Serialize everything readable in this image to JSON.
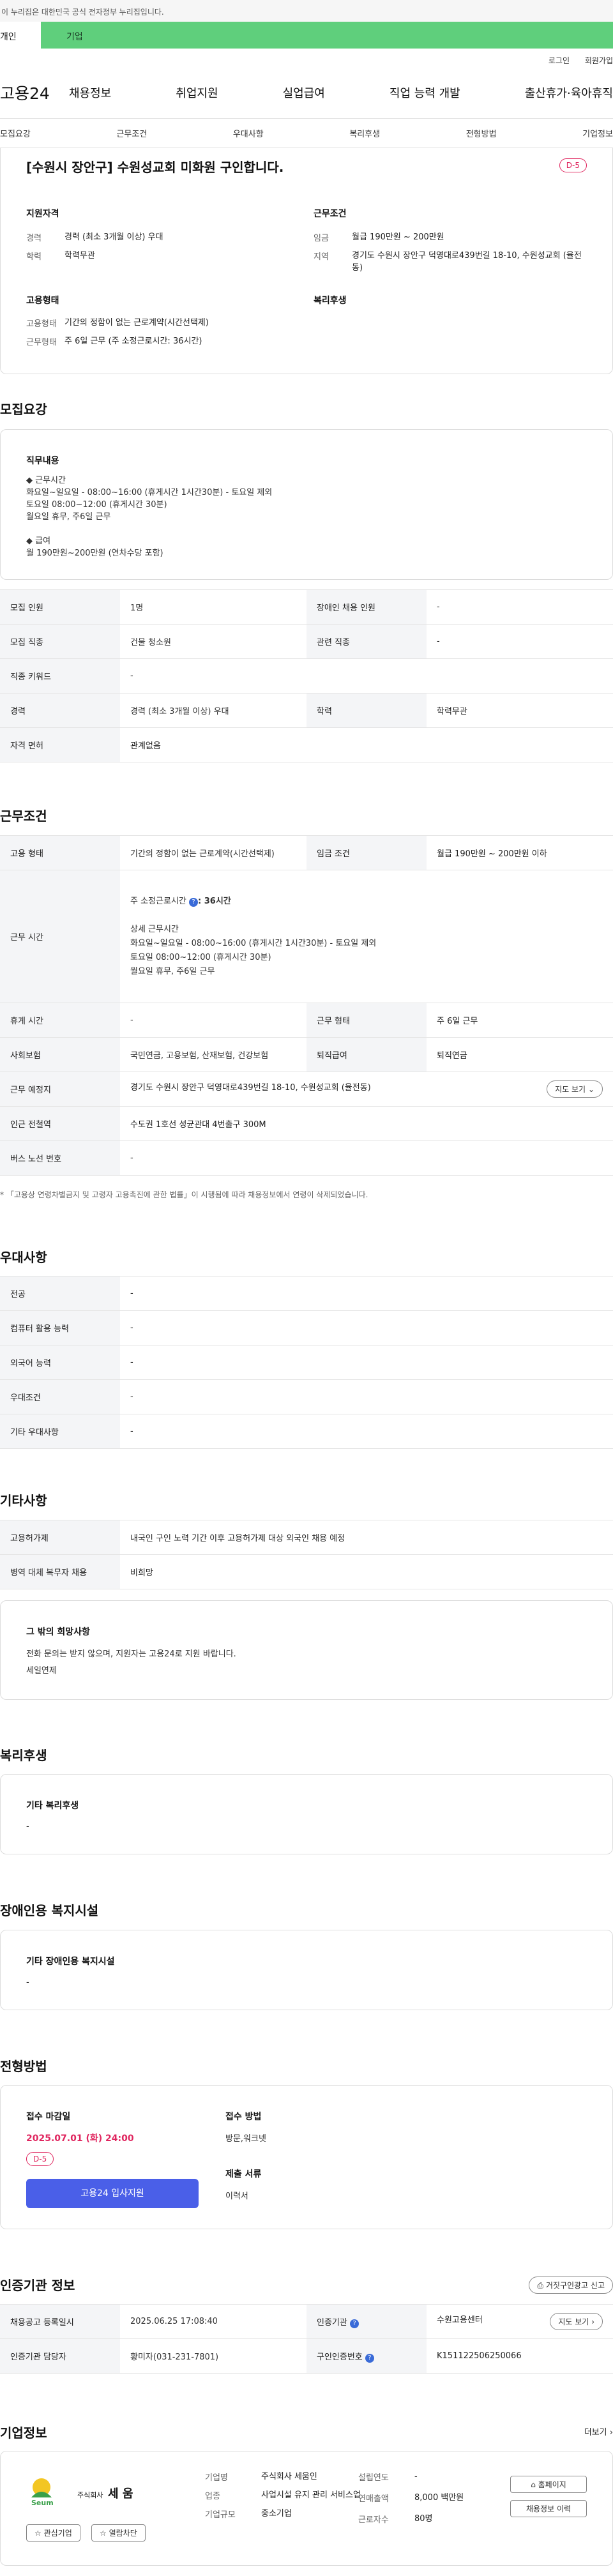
{
  "gov_banner": "이 누리집은 대한민국 공식 전자정부 누리집입니다.",
  "top_tabs": [
    "개인",
    "기업"
  ],
  "login_links": [
    "로그인",
    "회원가입"
  ],
  "logo": "고용24",
  "gnb": [
    "채용정보",
    "취업지원",
    "실업급여",
    "직업 능력 개발",
    "출산휴가·육아휴직"
  ],
  "snb": [
    "모집요강",
    "근무조건",
    "우대사항",
    "복리후생",
    "전형방법",
    "기업정보"
  ],
  "summary": {
    "title": "[수원시 장안구] 수원성교회 미화원 구인합니다.",
    "dday": "D-5",
    "left_heading": "지원자격",
    "left": [
      [
        "경력",
        "경력 (최소 3개월 이상) 우대"
      ],
      [
        "학력",
        "학력무관"
      ]
    ],
    "employment_heading": "고용형태",
    "employment": [
      [
        "고용형태",
        "기간의 정함이 없는 근로계약(시간선택제)"
      ],
      [
        "근무형태",
        "주 6일 근무 (주 소정근로시간: 36시간)"
      ]
    ],
    "right_heading": "근무조건",
    "right": [
      [
        "임금",
        "월급 190만원 ~ 200만원"
      ],
      [
        "지역",
        "경기도 수원시 장안구 덕영대로439번길 18-10, 수원성교회 (율전동)"
      ]
    ],
    "welfare_heading": "복리후생"
  },
  "recruit": {
    "heading": "모집요강",
    "duty_title": "직무내용",
    "duty_lines": [
      "◆ 근무시간",
      "화요일~일요일 - 08:00~16:00 (휴게시간 1시간30분) - 토요일 제외",
      "토요일 08:00~12:00 (휴게시간 30분)",
      "월요일 휴무, 주6일 근무",
      "",
      "◆ 급여",
      " 월 190만원~200만원 (연차수당 포함)"
    ],
    "rows": [
      [
        "모집 인원",
        "1명",
        "장애인 채용 인원",
        "-"
      ],
      [
        "모집 직종",
        "건물 청소원",
        "관련 직종",
        "-"
      ],
      [
        "직종 키워드",
        "-"
      ],
      [
        "경력",
        "경력 (최소 3개월 이상) 우대",
        "학력",
        "학력무관"
      ],
      [
        "자격 면허",
        "관계없음"
      ]
    ]
  },
  "conditions": {
    "heading": "근무조건",
    "emp_type": [
      "고용 형태",
      "기간의 정함이 없는 근로계약(시간선택제)",
      "임금 조건",
      "월급 190만원 ~ 200만원 이하"
    ],
    "work_time_label": "근무 시간",
    "weekly_hours": "주 소정근로시간",
    "weekly_hours_value": ": 36시간",
    "detail_label": "상세 근무시간",
    "detail_lines": [
      "화요일~일요일 - 08:00~16:00 (휴게시간 1시간30분) - 토요일 제외",
      "토요일 08:00~12:00 (휴게시간 30분)",
      "월요일 휴무, 주6일 근무"
    ],
    "rows": [
      [
        "휴게 시간",
        "-",
        "근무 형태",
        "주 6일 근무"
      ],
      [
        "사회보험",
        "국민연금, 고용보험, 산재보험, 건강보험",
        "퇴직급여",
        "퇴직연금"
      ]
    ],
    "place_label": "근무 예정지",
    "place_value": "경기도 수원시 장안구 덕영대로439번길 18-10, 수원성교회 (율전동)",
    "map_button": "지도 보기",
    "station_label": "인근 전철역",
    "station_value": "수도권 1호선 성균관대 4번출구 300M",
    "bus_label": "버스 노선 번호",
    "bus_value": "-",
    "footnote": "* 「고용상 연령차별금지 및 고령자 고용촉진에 관한 법률」이 시행됨에 따라 채용정보에서 연령이 삭제되었습니다."
  },
  "preference": {
    "heading": "우대사항",
    "rows": [
      [
        "전공",
        "-"
      ],
      [
        "컴퓨터 활용 능력",
        "-"
      ],
      [
        "외국어 능력",
        "-"
      ],
      [
        "우대조건",
        "-"
      ],
      [
        "기타 우대사항",
        "-"
      ]
    ]
  },
  "etc": {
    "heading": "기타사항",
    "rows": [
      [
        "고용허가제",
        "내국인 구인 노력 기간 이후 고용허가제 대상 외국인 채용 예정"
      ],
      [
        "병역 대체 복무자 채용",
        "비희망"
      ]
    ],
    "box_title": "그 밖의 희망사항",
    "box_lines": [
      "전화 문의는 받지 않으며, 지원자는 고용24로 지원 바랍니다.",
      "세일연제"
    ]
  },
  "welfare": {
    "heading": "복리후생",
    "box_title": "기타 복리후생",
    "box_value": "-"
  },
  "disabled": {
    "heading": "장애인용 복지시설",
    "box_title": "기타 장애인용 복지시설",
    "box_value": "-"
  },
  "selection": {
    "heading": "전형방법",
    "deadline_label": "접수 마감일",
    "deadline": "2025.07.01 (화) 24:00",
    "dday": "D-5",
    "apply_button": "고용24 입사지원",
    "method_label": "접수 방법",
    "method_value": "방문,워크넷",
    "docs_label": "제출 서류",
    "docs_value": "이력서"
  },
  "cert": {
    "heading": "인증기관 정보",
    "report_button": "거짓구인광고 신고",
    "rows": [
      [
        "채용공고 등록일시",
        "2025.06.25 17:08:40",
        "인증기관",
        "수원고용센터"
      ],
      [
        "인증기관 담당자",
        "황미자(031-231-7801)",
        "구인인증번호",
        "K151122506250066"
      ]
    ],
    "map_button": "지도 보기"
  },
  "company": {
    "heading": "기업정보",
    "more": "더보기",
    "logo_text": "Seum",
    "logo_sub": "주식회사",
    "logo_name": "세 움",
    "interest_button": "관심기업",
    "block_button": "열람차단",
    "fields_a": [
      [
        "기업명",
        "주식회사 세움인"
      ],
      [
        "업종",
        "사업시설 유지 관리 서비스업"
      ],
      [
        "기업규모",
        "중소기업"
      ]
    ],
    "fields_b": [
      [
        "설립연도",
        "-"
      ],
      [
        "연매출액",
        "8,000 백만원"
      ],
      [
        "근로자수",
        "80명"
      ]
    ],
    "homepage_button": "홈페이지",
    "jobs_button": "채용정보 이력"
  },
  "colors": {
    "brand_green": "#5fcf7c",
    "accent_red": "#e0265f",
    "apply_blue": "#4a5fe8",
    "info_blue": "#3a6bd8"
  }
}
